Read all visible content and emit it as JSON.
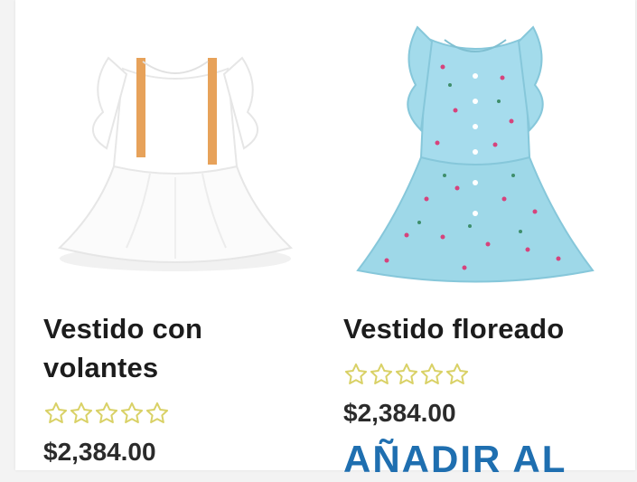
{
  "colors": {
    "title": "#1c1c1c",
    "price": "#2b2b2b",
    "star_outline": "#d9d166",
    "add_to_cart": "#1f6fb0"
  },
  "products": [
    {
      "title": "Vestido con volantes",
      "rating": 0,
      "rating_max": 5,
      "price": "$2,384.00",
      "image_icon": "white-ruffle-dress-image"
    },
    {
      "title": "Vestido floreado",
      "rating": 0,
      "rating_max": 5,
      "price": "$2,384.00",
      "add_to_cart_label": "AÑADIR AL",
      "image_icon": "blue-floral-dress-image"
    }
  ]
}
